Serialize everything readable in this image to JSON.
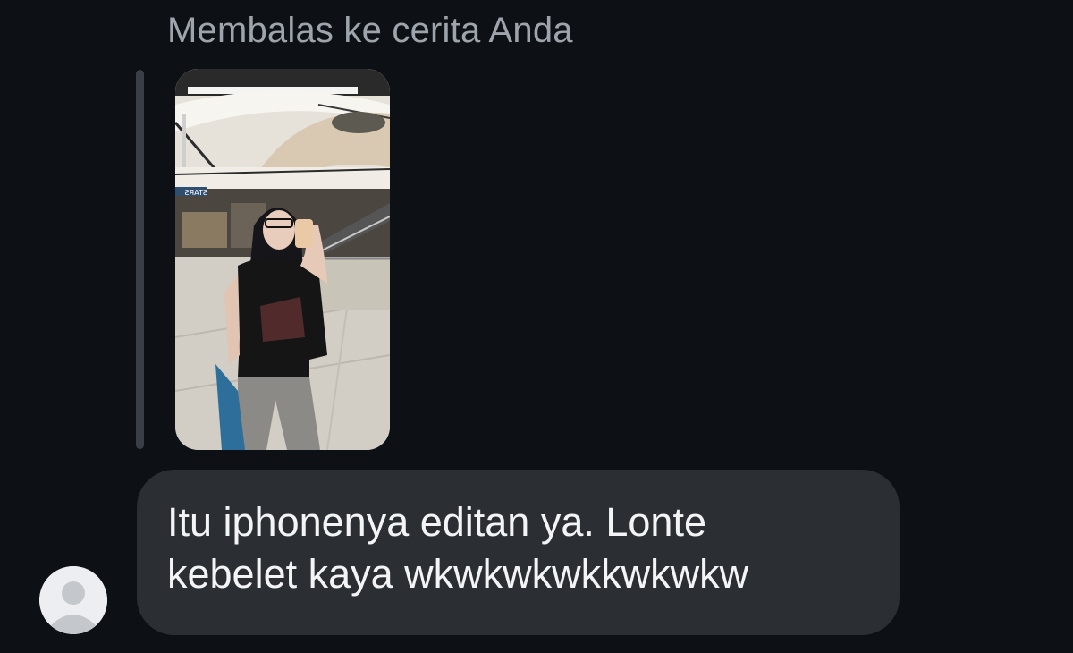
{
  "reply_context": {
    "caption": "Membalas ke cerita Anda",
    "story_image": {
      "description_icon": "story-photo-thumbnail",
      "sign_text": "STARS",
      "colors": {
        "ceiling": "#e9e6df",
        "floor": "#cfcac2",
        "shirt": "#141414",
        "pants": "#8c8c8a",
        "bag": "#2d6f9a",
        "phone": "#e9c9a6"
      }
    }
  },
  "message": {
    "line1": "Itu iphonenya editan ya. Lonte",
    "line2": "kebelet kaya wkwkwkwkkwkwkw"
  },
  "sender": {
    "avatar_icon": "default-profile-avatar-icon"
  },
  "colors": {
    "background": "#0d1014",
    "bubble": "#2b2f34",
    "caption_text": "#9ea4ab",
    "message_text": "#f3f4f6",
    "reply_bar": "#3a3f46"
  }
}
